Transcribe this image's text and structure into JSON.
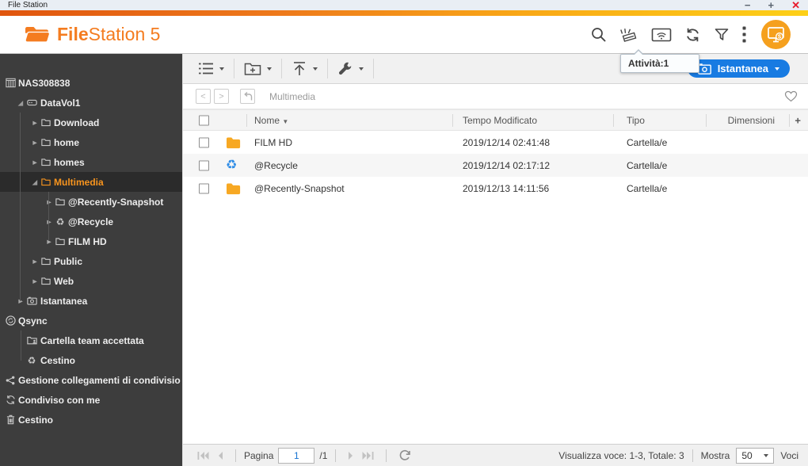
{
  "window": {
    "title": "File Station"
  },
  "header": {
    "logo_bold": "File",
    "logo_rest": "Station 5"
  },
  "colors": {
    "accent_orange": "#f47c20",
    "button_blue": "#187be2",
    "folder_yellow": "#f7a823",
    "recycle_blue": "#2e8ce6"
  },
  "sidebar": {
    "items": [
      {
        "label": "NAS308838",
        "icon": "nas",
        "level": 0
      },
      {
        "label": "DataVol1",
        "icon": "volume",
        "level": 1,
        "expander": "expanded"
      },
      {
        "label": "Download",
        "icon": "folder",
        "level": 2,
        "expander": "collapsed"
      },
      {
        "label": "home",
        "icon": "folder",
        "level": 2,
        "expander": "collapsed"
      },
      {
        "label": "homes",
        "icon": "folder",
        "level": 2,
        "expander": "collapsed"
      },
      {
        "label": "Multimedia",
        "icon": "folder",
        "level": 2,
        "expander": "expanded",
        "selected": true
      },
      {
        "label": "@Recently-Snapshot",
        "icon": "folder",
        "level": 3,
        "expander": "collapsed"
      },
      {
        "label": "@Recycle",
        "icon": "recycle",
        "level": 3,
        "expander": "collapsed"
      },
      {
        "label": "FILM HD",
        "icon": "folder",
        "level": 3,
        "expander": "collapsed"
      },
      {
        "label": "Public",
        "icon": "folder",
        "level": 2,
        "expander": "collapsed"
      },
      {
        "label": "Web",
        "icon": "folder",
        "level": 2,
        "expander": "collapsed"
      },
      {
        "label": "Istantanea",
        "icon": "snapshot",
        "level": 1,
        "expander": "collapsed"
      },
      {
        "label": "Qsync",
        "icon": "qsync",
        "level": 0
      },
      {
        "label": "Cartella team accettata",
        "icon": "team-folder",
        "level": 1
      },
      {
        "label": "Cestino",
        "icon": "recycle",
        "level": 1
      },
      {
        "label": "Gestione collegamenti di condivisio",
        "icon": "share",
        "level": 0
      },
      {
        "label": "Condiviso con me",
        "icon": "shared-with-me",
        "level": 0
      },
      {
        "label": "Cestino",
        "icon": "trash",
        "level": 0
      }
    ]
  },
  "toolbar": {
    "tooltip": "Attività:1",
    "snapshot_button": "Istantanea"
  },
  "breadcrumb": {
    "path": "Multimedia"
  },
  "table": {
    "columns": [
      {
        "label": "Nome",
        "sorted": "desc"
      },
      {
        "label": "Tempo Modificato"
      },
      {
        "label": "Tipo"
      },
      {
        "label": "Dimensioni"
      }
    ],
    "add_column_label": "+",
    "rows": [
      {
        "name": "FILM HD",
        "icon": "folder-fill",
        "modified": "2019/12/14 02:41:48",
        "type": "Cartella/e",
        "size": ""
      },
      {
        "name": "@Recycle",
        "icon": "recycle-blue",
        "modified": "2019/12/14 02:17:12",
        "type": "Cartella/e",
        "size": ""
      },
      {
        "name": "@Recently-Snapshot",
        "icon": "folder-fill",
        "modified": "2019/12/13 14:11:56",
        "type": "Cartella/e",
        "size": ""
      }
    ]
  },
  "footer": {
    "page_label": "Pagina",
    "page_value": "1",
    "page_total": "/1",
    "display_text": "Visualizza voce: 1-3, Totale: 3",
    "show_label": "Mostra",
    "show_value": "50",
    "items_label": "Voci"
  }
}
